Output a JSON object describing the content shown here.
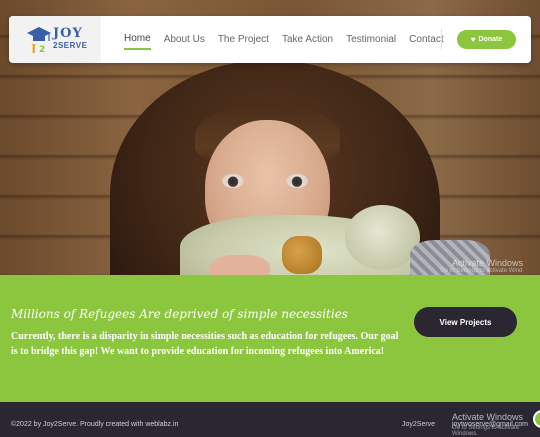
{
  "brand": {
    "logo_word": "JOY",
    "logo_sub": "2SERVE"
  },
  "nav": {
    "links": [
      {
        "label": "Home",
        "active": true
      },
      {
        "label": "About Us",
        "active": false
      },
      {
        "label": "The Project",
        "active": false
      },
      {
        "label": "Take Action",
        "active": false
      },
      {
        "label": "Testimonial",
        "active": false
      },
      {
        "label": "Contact",
        "active": false
      }
    ],
    "donate_label": "Donate",
    "donate_icon": "heart-icon"
  },
  "hero": {
    "watermark_title": "Activate Windows",
    "watermark_sub": "Go to Settings to activate Wind"
  },
  "band": {
    "title": "Millions of Refugees Are deprived of simple necessities",
    "text": "Currently, there is a disparity in simple necessities such as education for refugees. Our goal is to bridge this gap! We want to provide education for incoming refugees into America!",
    "button_label": "View Projects"
  },
  "footer": {
    "copyright": "©2022 by Joy2Serve. Proudly created with weblabz.in",
    "brand": "Joy2Serve",
    "email": "joytwoserve@gmail.com",
    "watermark_title": "Activate Windows",
    "watermark_sub": "Go to Settings to activate Windows."
  },
  "colors": {
    "accent": "#8cc63f",
    "dark": "#2a2733",
    "logo_blue": "#3b5ea8"
  }
}
